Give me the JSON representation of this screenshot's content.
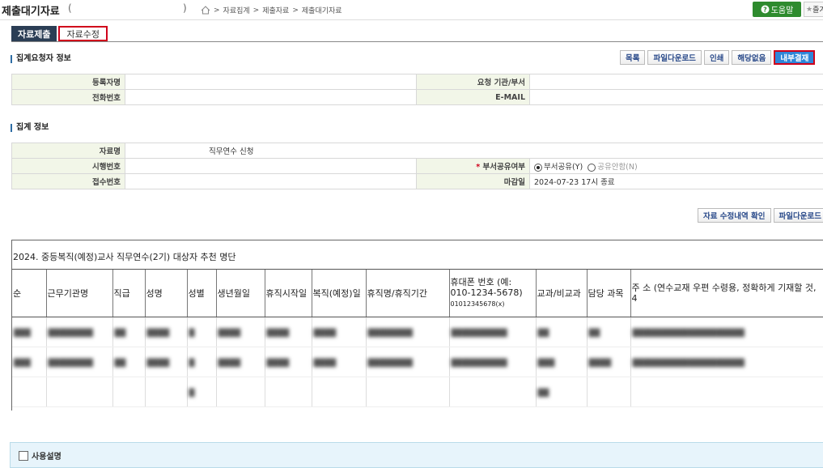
{
  "header": {
    "title": "제출대기자료",
    "paren_open": "(",
    "paren_close": ")",
    "breadcrumb": [
      "자료집계",
      "제출자료",
      "제출대기자료"
    ],
    "help_label": "도움말",
    "fav_label": "즐겨"
  },
  "tabs": [
    {
      "label": "자료제출",
      "active": true
    },
    {
      "label": "자료수정",
      "active": false
    }
  ],
  "requester": {
    "section_title": "집계요청자 정보",
    "buttons": [
      "목록",
      "파일다운로드",
      "인쇄",
      "해당없음",
      "내부결재"
    ],
    "rows": [
      {
        "l1": "등록자명",
        "v1": "",
        "l2": "요청 기관/부서",
        "v2": ""
      },
      {
        "l1": "전화번호",
        "v1": "",
        "l2": "E-MAIL",
        "v2": ""
      }
    ]
  },
  "summary": {
    "section_title": "집계 정보",
    "data_name_label": "자료명",
    "data_name_value": "직무연수 신청",
    "exec_label": "시행번호",
    "share_label": "부서공유여부",
    "share_required": "*",
    "share_opt1": "부서공유(Y)",
    "share_opt2": "공유안함(N)",
    "receipt_label": "접수번호",
    "deadline_label": "마감일",
    "deadline_value": "2024-07-23 17시 종료"
  },
  "actions": {
    "buttons": [
      "자료 수정내역 확인",
      "파일다운로드"
    ]
  },
  "doc": {
    "title": "2024. 중등복직(예정)교사 직무연수(2기) 대상자 추천 명단",
    "columns": [
      {
        "label": "순",
        "sub": ""
      },
      {
        "label": "근무기관명",
        "sub": ""
      },
      {
        "label": "직급",
        "sub": ""
      },
      {
        "label": "성명",
        "sub": ""
      },
      {
        "label": "성별",
        "sub": ""
      },
      {
        "label": "생년월일",
        "sub": ""
      },
      {
        "label": "휴직시작일",
        "sub": ""
      },
      {
        "label": "복직(예정)일",
        "sub": ""
      },
      {
        "label": "휴직명/휴직기간",
        "sub": ""
      },
      {
        "label": "휴대폰 번호 (예: 010-1234-5678)",
        "sub": "01012345678(x)"
      },
      {
        "label": "교과/비교과",
        "sub": ""
      },
      {
        "label": "담당 과목",
        "sub": ""
      },
      {
        "label": "주 소 (연수교재 우편 수령용, 정확하게 기재할 것, 4",
        "sub": ""
      }
    ]
  },
  "guide": {
    "title": "사용설명"
  }
}
